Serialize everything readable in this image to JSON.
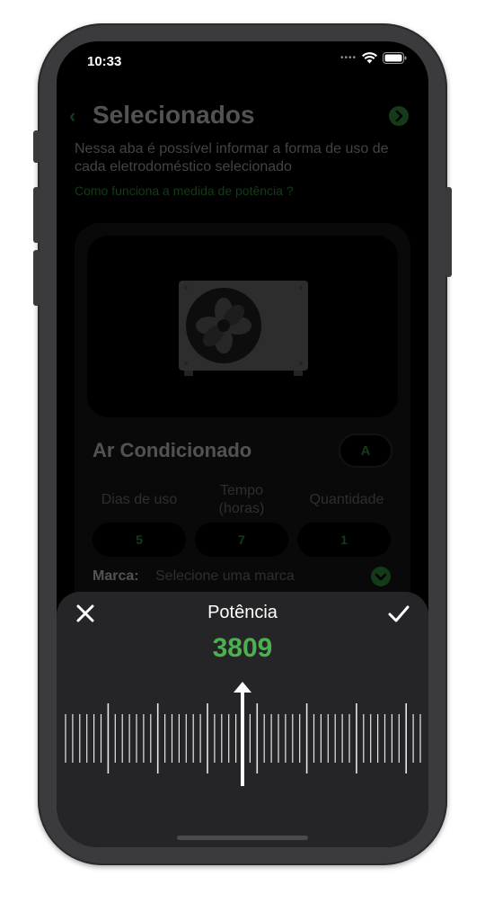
{
  "status_bar": {
    "time": "10:33"
  },
  "header": {
    "title": "Selecionados"
  },
  "description": "Nessa aba é possível informar a forma de uso de cada eletrodoméstico selecionado",
  "help_link": "Como funciona a medida de potência ?",
  "appliance": {
    "name": "Ar Condicionado",
    "energy_class": "A",
    "usage_days_label": "Dias de uso",
    "usage_time_label": "Tempo\n(horas)",
    "quantity_label": "Quantidade",
    "usage_days": "5",
    "usage_hours": "7",
    "quantity": "1",
    "brand_label": "Marca:",
    "brand_placeholder": "Selecione uma marca"
  },
  "picker": {
    "title": "Potência",
    "value": "3809"
  },
  "colors": {
    "accent": "#3fb34f",
    "sheet_background": "#252527",
    "background": "#000000"
  }
}
